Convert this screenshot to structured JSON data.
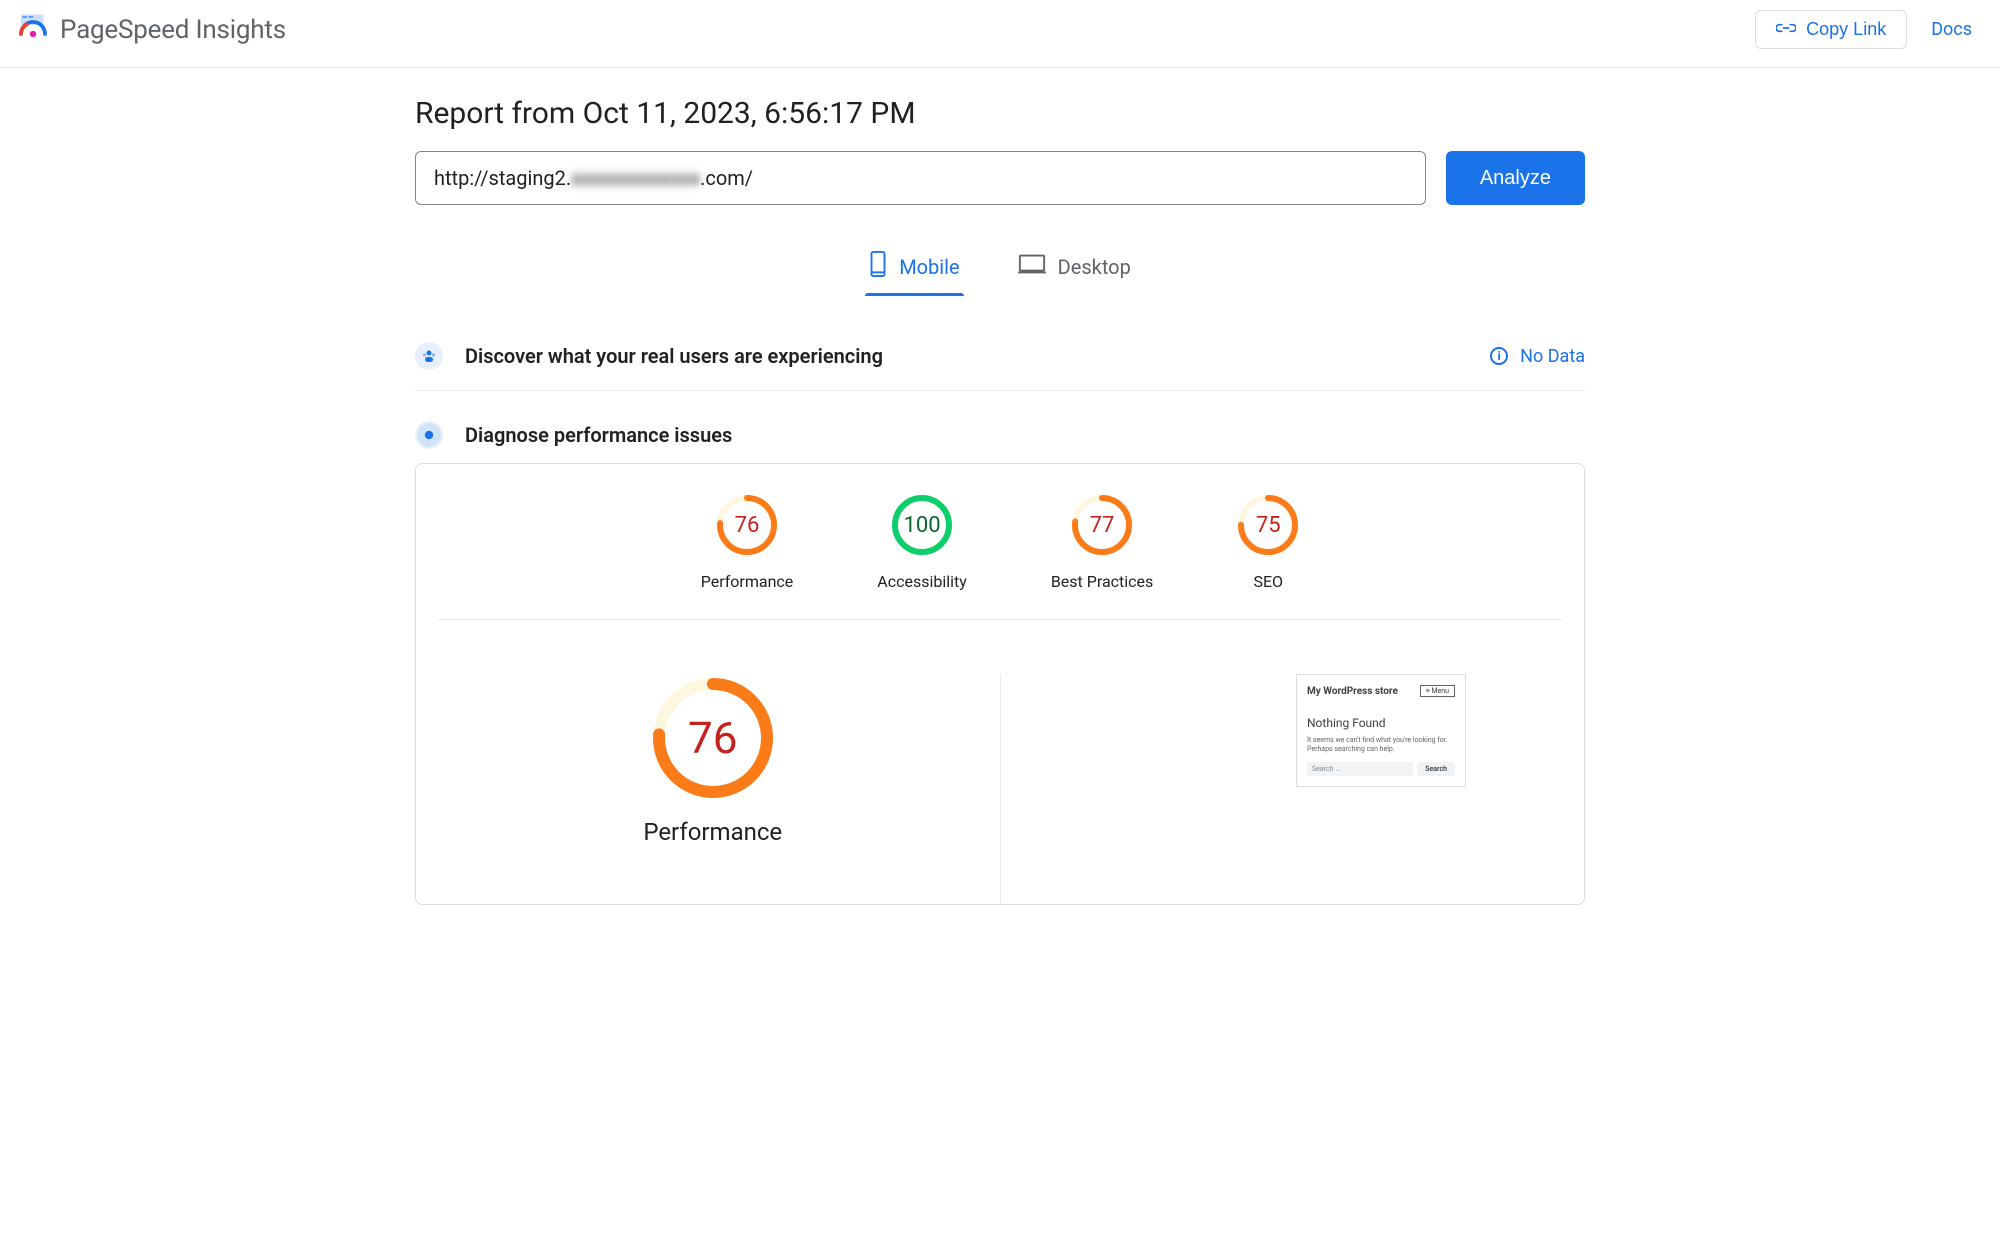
{
  "header": {
    "app_title": "PageSpeed Insights",
    "copy_link_label": "Copy Link",
    "docs_label": "Docs"
  },
  "report": {
    "title": "Report from Oct 11, 2023, 6:56:17 PM",
    "url_prefix": "http://staging2.",
    "url_blur": "xxxxxxxxxxxxx",
    "url_suffix": ".com/",
    "analyze_label": "Analyze"
  },
  "tabs": {
    "mobile": "Mobile",
    "desktop": "Desktop"
  },
  "real_users": {
    "heading": "Discover what your real users are experiencing",
    "nodata": "No Data"
  },
  "diagnose": {
    "heading": "Diagnose performance issues"
  },
  "gauges": [
    {
      "value": 76,
      "label": "Performance",
      "color": "#fa7b17",
      "bg": "#fef7e0",
      "text": "#c5221f"
    },
    {
      "value": 100,
      "label": "Accessibility",
      "color": "#0cce6b",
      "bg": "#e6f4ea",
      "text": "#0d652d"
    },
    {
      "value": 77,
      "label": "Best Practices",
      "color": "#fa7b17",
      "bg": "#fef7e0",
      "text": "#c5221f"
    },
    {
      "value": 75,
      "label": "SEO",
      "color": "#fa7b17",
      "bg": "#fef7e0",
      "text": "#c5221f"
    }
  ],
  "big_gauge": {
    "value": 76,
    "label": "Performance",
    "color": "#fa7b17",
    "bg": "#fef7e0",
    "text": "#c5221f"
  },
  "thumbnail": {
    "site_title": "My WordPress store",
    "menu": "≡ Menu",
    "h2": "Nothing Found",
    "p": "It seems we can't find what you're looking for. Perhaps searching can help.",
    "search_ph": "Search …",
    "search_btn": "Search"
  },
  "colors": {
    "accent": "#1a73e8"
  }
}
